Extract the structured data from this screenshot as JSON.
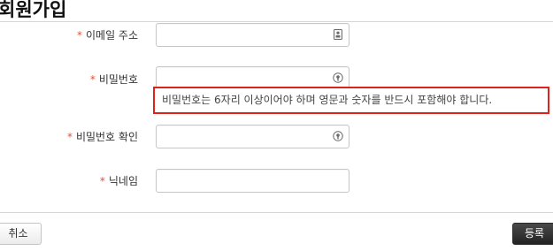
{
  "page": {
    "title": "회원가입"
  },
  "form": {
    "required_mark": "*",
    "email": {
      "label": "이메일 주소",
      "value": "",
      "icon": "id-card-icon"
    },
    "password": {
      "label": "비밀번호",
      "value": "",
      "icon": "key-icon"
    },
    "password_hint": "비밀번호는 6자리 이상이어야 하며 영문과 숫자를 반드시 포함해야 합니다.",
    "password_confirm": {
      "label": "비밀번호 확인",
      "value": "",
      "icon": "key-icon"
    },
    "nickname": {
      "label": "닉네임",
      "value": ""
    }
  },
  "actions": {
    "cancel_label": "취소",
    "submit_label": "등록"
  },
  "colors": {
    "required": "#e0533b",
    "tooltip_border": "#e0221c",
    "submit_bg": "#2f2f2f"
  }
}
